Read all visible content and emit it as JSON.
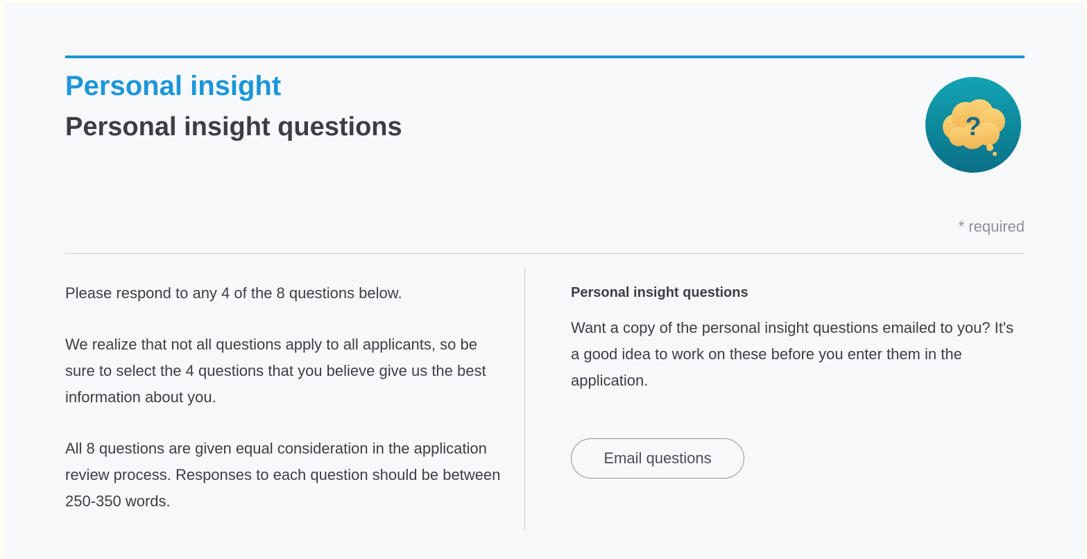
{
  "header": {
    "section_title": "Personal insight",
    "page_title": "Personal insight questions",
    "required_note": "* required"
  },
  "icon": {
    "name": "thought-bubble-question-icon",
    "glyph": "?",
    "circle_color": "#0d8a9c",
    "bubble_color": "#f5c35a"
  },
  "left": {
    "paragraphs": [
      "Please respond to any 4 of the 8 questions below.",
      "We realize that not all questions apply to all applicants, so be sure to select the 4 questions that you believe give us the best information about you.",
      "All 8 questions are given equal consideration in the application review process. Responses to each question should be between 250-350 words."
    ]
  },
  "right": {
    "heading": "Personal insight questions",
    "text": "Want a copy of the personal insight questions emailed to you? It's a good idea to work on these before you enter them in the application.",
    "button_label": "Email questions"
  },
  "colors": {
    "accent": "#1a95d6",
    "text": "#3b3f44",
    "muted": "#8b8f94"
  }
}
